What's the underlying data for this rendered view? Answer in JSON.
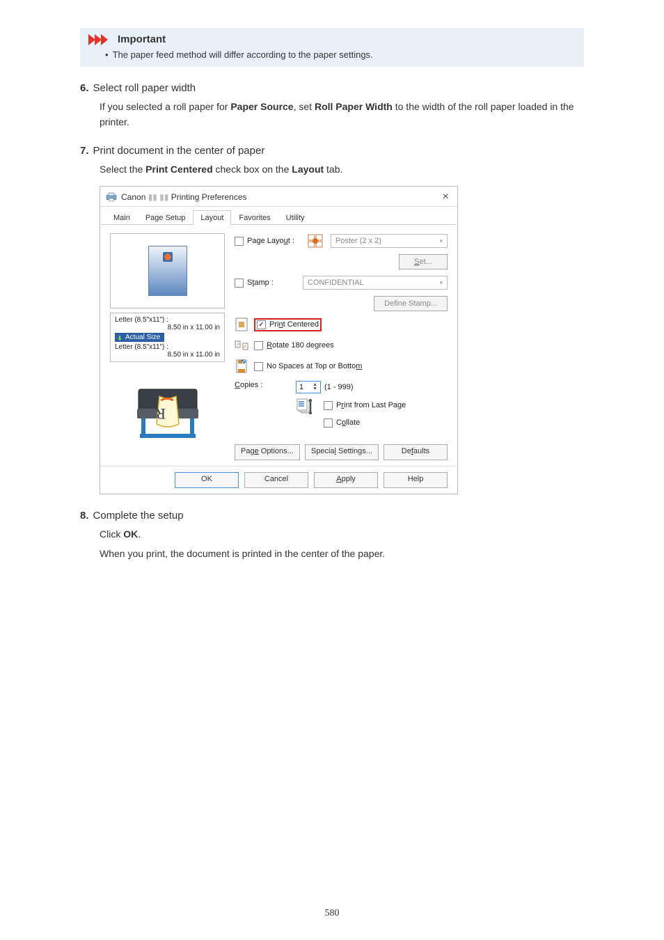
{
  "important": {
    "title": "Important",
    "text": "The paper feed method will differ according to the paper settings."
  },
  "step6": {
    "num": "6.",
    "title": "Select roll paper width",
    "body_1": "If you selected a roll paper for ",
    "body_bold1": "Paper Source",
    "body_2": ", set ",
    "body_bold2": "Roll Paper Width",
    "body_3": " to the width of the roll paper loaded in the printer."
  },
  "step7": {
    "num": "7.",
    "title": "Print document in the center of paper",
    "body_1": "Select the ",
    "body_bold1": "Print Centered",
    "body_2": " check box on the ",
    "body_bold2": "Layout",
    "body_3": " tab."
  },
  "step8": {
    "num": "8.",
    "title": "Complete the setup",
    "body_1a": "Click ",
    "body_1b": "OK",
    "body_1c": ".",
    "body_2": "When you print, the document is printed in the center of the paper."
  },
  "dialog": {
    "title_prefix": "Canon ",
    "title_suffix": " Printing Preferences",
    "close": "×",
    "tabs": {
      "main": "Main",
      "page_setup": "Page Setup",
      "layout": "Layout",
      "favorites": "Favorites",
      "utility": "Utility"
    },
    "size1_a": "Letter (8.5\"x11\") :",
    "size1_b": "8.50 in x 11.00 in",
    "actual_size": "Actual Size",
    "size2_a": "Letter (8.5\"x11\") :",
    "size2_b": "8.50 in x 11.00 in",
    "page_layout_lbl": "Page Layout :",
    "poster_text": "Poster (2 x 2)",
    "set_btn": "Set...",
    "stamp_lbl": "Stamp :",
    "stamp_value": "CONFIDENTIAL",
    "define_stamp": "Define Stamp...",
    "print_centered": "Print Centered",
    "rotate_180": "Rotate 180 degrees",
    "no_spaces": "No Spaces at Top or Bottom",
    "copies_lbl": "Copies :",
    "copies_val": "1",
    "copies_range": "(1 - 999)",
    "print_last": "Print from Last Page",
    "collate": "Collate",
    "page_options": "Page Options...",
    "special_settings": "Special Settings...",
    "defaults": "Defaults",
    "ok": "OK",
    "cancel": "Cancel",
    "apply": "Apply",
    "help": "Help"
  },
  "page_number": "580"
}
